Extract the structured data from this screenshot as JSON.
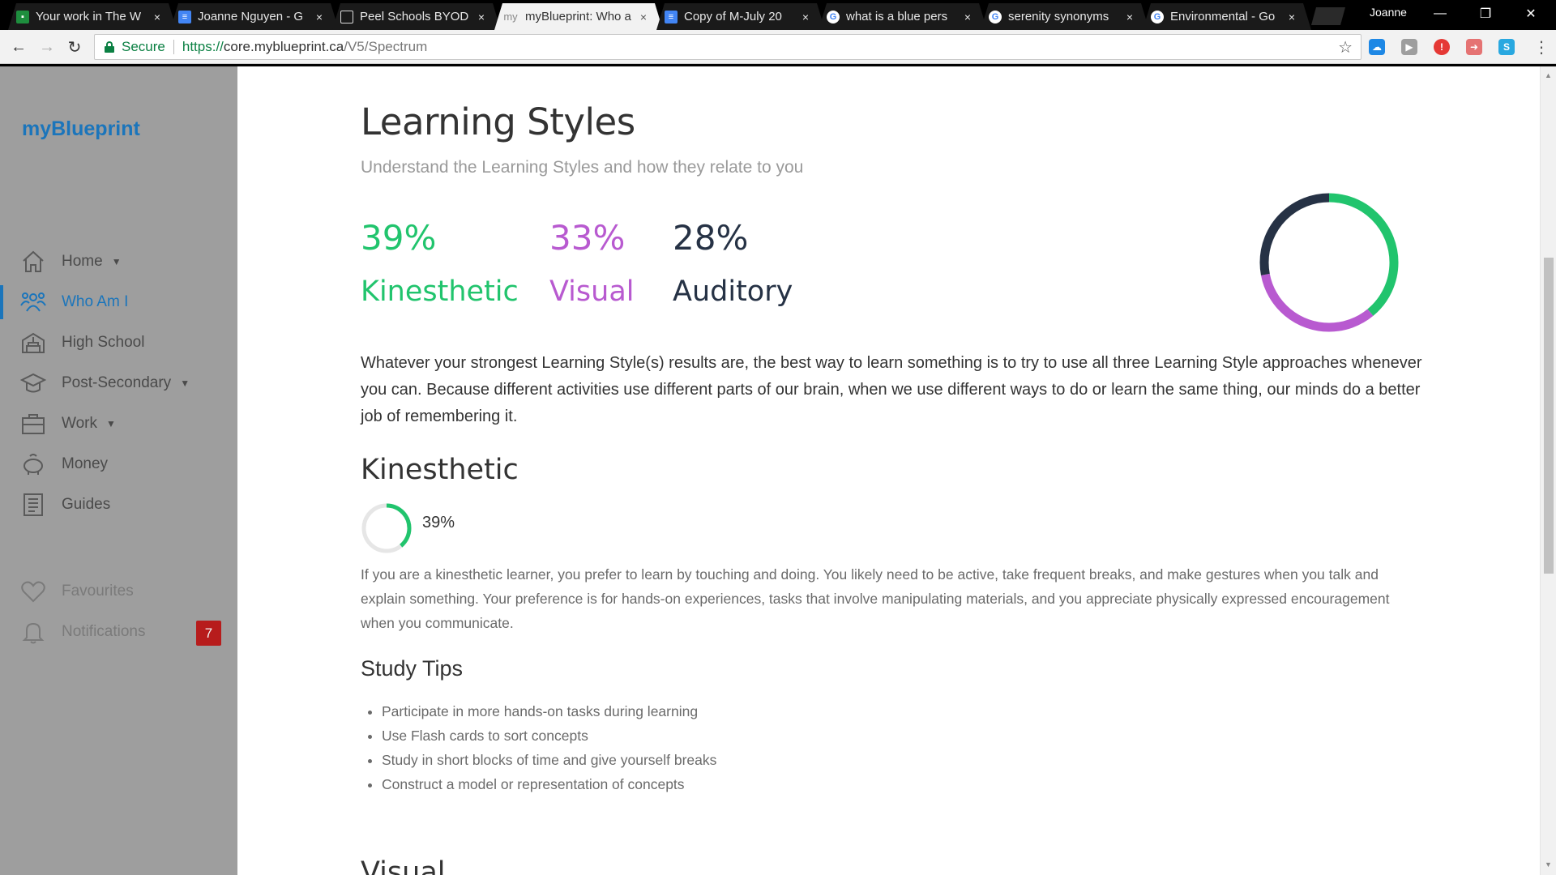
{
  "browser": {
    "tabs": [
      {
        "label": "Your work in The W",
        "icon": "classroom-icon",
        "color": "#1e8e3e",
        "active": false
      },
      {
        "label": "Joanne Nguyen - G",
        "icon": "docs-icon",
        "color": "#4285f4",
        "active": false
      },
      {
        "label": "Peel Schools BYOD",
        "icon": "page-icon",
        "color": "#ffffff",
        "active": false
      },
      {
        "label": "myBlueprint: Who a",
        "icon": "myblueprint-icon",
        "color": "#888888",
        "active": true
      },
      {
        "label": "Copy of M-July 20",
        "icon": "docs-icon",
        "color": "#4285f4",
        "active": false
      },
      {
        "label": "what is a blue pers",
        "icon": "google-icon",
        "color": "#ffffff",
        "active": false
      },
      {
        "label": "serenity synonyms",
        "icon": "google-icon",
        "color": "#ffffff",
        "active": false
      },
      {
        "label": "Environmental - Go",
        "icon": "google-icon",
        "color": "#ffffff",
        "active": false
      }
    ],
    "profile_name": "Joanne",
    "secure_label": "Secure",
    "url_scheme": "https://",
    "url_host": "core.myblueprint.ca",
    "url_path": "/V5/Spectrum",
    "tab_close_glyph": "×",
    "tab_myblueprint_glyph": "my",
    "window_controls": {
      "minimize": "—",
      "maximize": "❐",
      "close": "✕"
    },
    "nav_glyphs": {
      "back": "←",
      "forward": "→",
      "reload": "↻",
      "star": "☆",
      "menu": "⋮"
    }
  },
  "sidebar": {
    "brand": "myBlueprint",
    "items": [
      {
        "label": "Home",
        "icon": "home-icon",
        "has_caret": true,
        "active": false
      },
      {
        "label": "Who Am I",
        "icon": "people-icon",
        "has_caret": false,
        "active": true
      },
      {
        "label": "High School",
        "icon": "school-icon",
        "has_caret": false,
        "active": false
      },
      {
        "label": "Post-Secondary",
        "icon": "graduation-cap-icon",
        "has_caret": true,
        "active": false
      },
      {
        "label": "Work",
        "icon": "briefcase-icon",
        "has_caret": true,
        "active": false
      },
      {
        "label": "Money",
        "icon": "piggy-bank-icon",
        "has_caret": false,
        "active": false
      },
      {
        "label": "Guides",
        "icon": "guide-book-icon",
        "has_caret": false,
        "active": false
      }
    ],
    "favourites_label": "Favourites",
    "notifications_label": "Notifications",
    "notifications_count": "7",
    "caret_glyph": "▼",
    "accent_color": "#1b75bb",
    "badge_color": "#b71c1c"
  },
  "page": {
    "title": "Learning Styles",
    "subtitle": "Understand the Learning Styles and how they relate to you",
    "styles": [
      {
        "name": "Kinesthetic",
        "percent": "39%",
        "value": 39,
        "color": "#21c46d"
      },
      {
        "name": "Visual",
        "percent": "33%",
        "value": 33,
        "color": "#b85ad0"
      },
      {
        "name": "Auditory",
        "percent": "28%",
        "value": 28,
        "color": "#263245"
      }
    ],
    "intro": "Whatever your strongest Learning Style(s) results are, the best way to learn something is to try to use all three Learning Style approaches whenever you can. Because different activities use different parts of our brain, when we use different ways to do or learn the same thing, our minds do a better job of remembering it.",
    "section": {
      "title": "Kinesthetic",
      "percent": "39%",
      "value": 39,
      "description": "If you are a kinesthetic learner, you prefer to learn by touching and doing. You likely need to be active, take frequent breaks, and make gestures when you talk and explain something. Your preference is for hands-on experiences, tasks that involve manipulating materials, and you appreciate physically expressed encouragement when you communicate.",
      "tips_title": "Study Tips",
      "tips": [
        "Participate in more hands-on tasks during learning",
        "Use Flash cards to sort concepts",
        "Study in short blocks of time and give yourself breaks",
        "Construct a model or representation of concepts"
      ]
    },
    "next_section_title": "Visual"
  }
}
